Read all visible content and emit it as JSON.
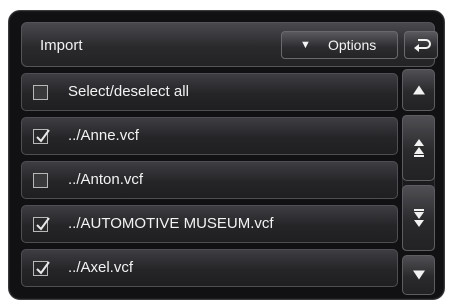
{
  "header": {
    "title": "Import",
    "options_label": "Options",
    "options_arrow": "▼"
  },
  "rows": [
    {
      "label": "Select/deselect all",
      "checked": false
    },
    {
      "label": "../Anne.vcf",
      "checked": true
    },
    {
      "label": "../Anton.vcf",
      "checked": false
    },
    {
      "label": "../AUTOMOTIVE MUSEUM.vcf",
      "checked": true
    },
    {
      "label": "../Axel.vcf",
      "checked": true
    }
  ],
  "scroll": {
    "up_icon": "triangle-up-icon",
    "page_up_icon": "double-chevron-up-icon",
    "page_down_icon": "double-chevron-down-icon",
    "down_icon": "triangle-down-icon"
  },
  "colors": {
    "background": "#111113",
    "text": "#f2f2f2",
    "button_border": "#6a6a6e"
  }
}
